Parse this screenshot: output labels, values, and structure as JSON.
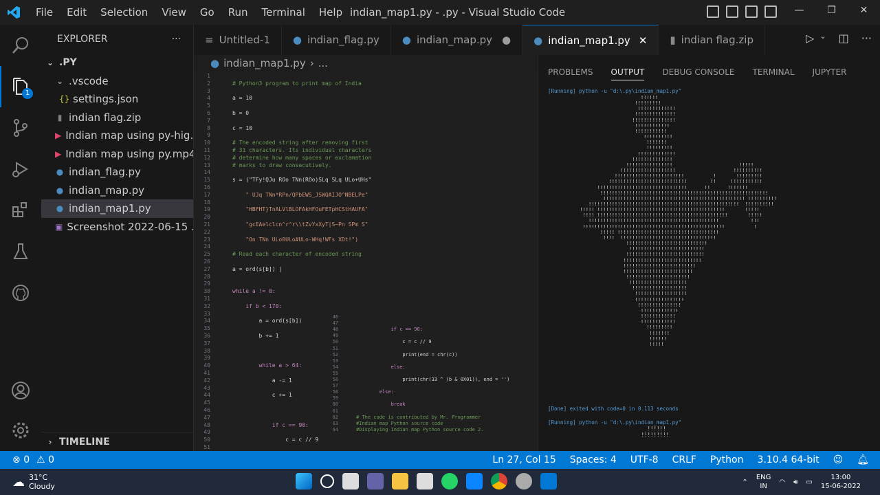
{
  "window_title": "indian_map1.py - .py - Visual Studio Code",
  "menu": [
    "File",
    "Edit",
    "Selection",
    "View",
    "Go",
    "Run",
    "Terminal",
    "Help"
  ],
  "window_controls": [
    "minimize-icon",
    "restore-icon",
    "close-icon"
  ],
  "explorer": {
    "title": "EXPLORER",
    "more": "···",
    "root": ".PY",
    "items": [
      {
        "label": ".vscode",
        "icon": "chevron-down-icon",
        "indent": 1
      },
      {
        "label": "settings.json",
        "icon": "json-icon",
        "indent": 2
      },
      {
        "label": "indian flag.zip",
        "icon": "zip-icon",
        "indent": 1
      },
      {
        "label": "Indian map using py-hig...",
        "icon": "video-icon",
        "indent": 1
      },
      {
        "label": "Indian map using py.mp4",
        "icon": "video-icon",
        "indent": 1
      },
      {
        "label": "indian_flag.py",
        "icon": "python-icon",
        "indent": 1
      },
      {
        "label": "indian_map.py",
        "icon": "python-icon",
        "indent": 1
      },
      {
        "label": "indian_map1.py",
        "icon": "python-icon",
        "indent": 1,
        "selected": true
      },
      {
        "label": "Screenshot 2022-06-15 ...",
        "icon": "image-icon",
        "indent": 1
      }
    ],
    "timeline": "TIMELINE"
  },
  "activity_badge": "1",
  "tabs": [
    {
      "label": "Untitled-1",
      "icon": "file-icon"
    },
    {
      "label": "indian_flag.py",
      "icon": "python-icon"
    },
    {
      "label": "indian_map.py",
      "icon": "python-icon",
      "modified": "●"
    },
    {
      "label": "indian_map1.py",
      "icon": "python-icon",
      "active": true,
      "close": "✕"
    },
    {
      "label": "indian flag.zip",
      "icon": "zip-icon"
    }
  ],
  "breadcrumb": {
    "file": "indian_map1.py",
    "rest": "..."
  },
  "code": [
    {
      "n": "1",
      "t": ""
    },
    {
      "n": "2",
      "t": "# Python3 program to print map of India",
      "c": "cm"
    },
    {
      "n": "3",
      "t": ""
    },
    {
      "n": "4",
      "t": "a = 10"
    },
    {
      "n": "5",
      "t": ""
    },
    {
      "n": "6",
      "t": "b = 0"
    },
    {
      "n": "7",
      "t": ""
    },
    {
      "n": "8",
      "t": "c = 10"
    },
    {
      "n": "9",
      "t": ""
    },
    {
      "n": "10",
      "t": "# The encoded string after removing first",
      "c": "cm"
    },
    {
      "n": "11",
      "t": "# 31 characters. Its individual characters",
      "c": "cm"
    },
    {
      "n": "12",
      "t": "# determine how many spaces or exclamation",
      "c": "cm"
    },
    {
      "n": "13",
      "t": "# marks to draw consecutively.",
      "c": "cm"
    },
    {
      "n": "14",
      "t": ""
    },
    {
      "n": "15",
      "t": "s = (\"TFy!QJu ROo TNn(ROo)SLq SLq ULo+UHs\""
    },
    {
      "n": "16",
      "t": ""
    },
    {
      "n": "17",
      "t": "    \" UJq TNn*RPn/QPbEWS_JSWQAIJO^NBELPe\"",
      "c": "st"
    },
    {
      "n": "18",
      "t": ""
    },
    {
      "n": "19",
      "t": "    \"HBFHT}TnALVlBLOFAkHFOuFETpHCStHAUFA\"",
      "c": "st"
    },
    {
      "n": "20",
      "t": ""
    },
    {
      "n": "21",
      "t": "    \"gcEAelclcn^r^r\\\\tZvYxXyT|S~Pn SPm S\"",
      "c": "st"
    },
    {
      "n": "22",
      "t": ""
    },
    {
      "n": "23",
      "t": "    \"On TNn ULo0ULo#ULo-WHq!WFs XDt!\")",
      "c": "st"
    },
    {
      "n": "24",
      "t": ""
    },
    {
      "n": "25",
      "t": "# Read each character of encoded string",
      "c": "cm"
    },
    {
      "n": "26",
      "t": ""
    },
    {
      "n": "27",
      "t": "a = ord(s[b]) |"
    },
    {
      "n": "28",
      "t": ""
    },
    {
      "n": "29",
      "t": ""
    },
    {
      "n": "30",
      "t": "while a != 0:",
      "c": "kw"
    },
    {
      "n": "31",
      "t": ""
    },
    {
      "n": "32",
      "t": "    if b < 170:",
      "c": "kw"
    },
    {
      "n": "33",
      "t": ""
    },
    {
      "n": "34",
      "t": "        a = ord(s[b])"
    },
    {
      "n": "35",
      "t": ""
    },
    {
      "n": "36",
      "t": "        b += 1"
    },
    {
      "n": "37",
      "t": ""
    },
    {
      "n": "38",
      "t": ""
    },
    {
      "n": "39",
      "t": ""
    },
    {
      "n": "40",
      "t": "        while a > 64:",
      "c": "kw"
    },
    {
      "n": "41",
      "t": ""
    },
    {
      "n": "42",
      "t": "            a -= 1"
    },
    {
      "n": "43",
      "t": ""
    },
    {
      "n": "44",
      "t": "            c += 1"
    },
    {
      "n": "45",
      "t": ""
    },
    {
      "n": "46",
      "t": ""
    },
    {
      "n": "47",
      "t": ""
    },
    {
      "n": "48",
      "t": "            if c == 90:",
      "c": "kw"
    },
    {
      "n": "49",
      "t": ""
    },
    {
      "n": "50",
      "t": "                c = c // 9"
    },
    {
      "n": "51",
      "t": ""
    }
  ],
  "peek": [
    {
      "n": "46",
      "t": ""
    },
    {
      "n": "47",
      "t": ""
    },
    {
      "n": "48",
      "t": "            if c == 90:",
      "c": "kw"
    },
    {
      "n": "49",
      "t": ""
    },
    {
      "n": "50",
      "t": "                c = c // 9"
    },
    {
      "n": "51",
      "t": ""
    },
    {
      "n": "52",
      "t": "                print(end = chr(c))"
    },
    {
      "n": "53",
      "t": ""
    },
    {
      "n": "54",
      "t": "            else:",
      "c": "kw"
    },
    {
      "n": "55",
      "t": ""
    },
    {
      "n": "56",
      "t": "                print(chr(33 ^ (b & 0X01)), end = '')"
    },
    {
      "n": "57",
      "t": ""
    },
    {
      "n": "58",
      "t": "        else:",
      "c": "kw"
    },
    {
      "n": "59",
      "t": ""
    },
    {
      "n": "60",
      "t": "            break",
      "c": "kw"
    },
    {
      "n": "61",
      "t": ""
    },
    {
      "n": "62",
      "t": "# The code is contributed by Mr. Programmer",
      "c": "cm"
    },
    {
      "n": "63",
      "t": "#Indian map Python source code",
      "c": "cm"
    },
    {
      "n": "64",
      "t": "#Displaying Indian map Python source code 2.",
      "c": "cm"
    }
  ],
  "panel": {
    "tabs": [
      "PROBLEMS",
      "OUTPUT",
      "DEBUG CONSOLE",
      "TERMINAL",
      "JUPYTER"
    ],
    "active_tab": "OUTPUT",
    "run_line": "[Running] python -u \"d:\\.py\\indian_map1.py\"",
    "map_lines": [
      "                                !!!!!!",
      "                              !!!!!!!!!",
      "                               !!!!!!!!!!!!!",
      "                              !!!!!!!!!!!!!!",
      "                             !!!!!!!!!!!!!!!",
      "                              !!!!!!!!!!!!",
      "                              !!!!!!!!!!!",
      "                                 !!!!!!!!!!",
      "                                  !!!!!!!",
      "                                  !!!!!!!!!",
      "                               !!!!!!!!!!!!!",
      "                             !!!!!!!!!!!!!!",
      "                           !!!!!!!!!!!!!!!!                       !!!!!",
      "                         !!!!!!!!!!!!!!!!!!!                    !!!!!!!!!!",
      "                       !!!!!!!!!!!!!!!!!!!!!!!!          !       !!!!!!!!!",
      "                     !!!!!!!!!!!!!!!!!!!!!!!!!!!        !!     !!!!!!!!!!!",
      "                 !!!!!!!!!!!!!!!!!!!!!!!!!!!!!!!      !!      !!!!!!!",
      "                  !!!!!!!!!!!!!!!!!!!!!!!!!!!!!!!!!!!!!!!!!!!!!!!!!!!!!!!!!!",
      "                   !!!!!!!!!!!!!!!!!!!!!!!!!!!!!!!!!!!!!!!!!!!!!!!!! !!!!!!!!!!",
      "              !!!!!!!!!!!!!!!!!!!!!!!!!!!!!!!!!!!!!!!!!!!!!!!!!!!!  !!!!!!!!!!",
      "           !!!!! !!!!!!!!!!!!!!!!!!!!!!!!!!!!!!!!!!!!!!!!!!!!       !!!!!",
      "            !!!! !!!!!!!!!!!!!!!!!!!!!!!!!!!!!!!!!!!!!!!!!!!!!       !!!!!",
      "              !!!!!!!!!!!!!!!!!!!!!!!!!!!!!!!!!!!!!!!!!!!!!           !!!",
      "            !!!!!!!!!!!!!!!!!!!!!!!!!!!!!!!!!!!!!!!!!!!!!!!!!          !",
      "                  !!!!! !!!!!!!!!!!!!!!!!!!!!!!!!!!!!!!!!!!",
      "                   !!!!  !!!!!!!!!!!!!!!!!!!!!!!!!!!!!!!!!",
      "                           !!!!!!!!!!!!!!!!!!!!!!!!!!!!",
      "                            !!!!!!!!!!!!!!!!!!!!!!!!!!",
      "                           !!!!!!!!!!!!!!!!!!!!!!!!!!!",
      "                          !!!!!!!!!!!!!!!!!!!!!!!!!!!",
      "                          !!!!!!!!!!!!!!!!!!!!!!!!!",
      "                          !!!!!!!!!!!!!!!!!!!!!!!!",
      "                           !!!!!!!!!!!!!!!!!!!!!!",
      "                            !!!!!!!!!!!!!!!!!!!!",
      "                             !!!!!!!!!!!!!!!!!!!",
      "                              !!!!!!!!!!!!!!!!!!",
      "                              !!!!!!!!!!!!!!!!!",
      "                               !!!!!!!!!!!!!!!",
      "                                !!!!!!!!!!!!!",
      "                                !!!!!!!!!!!!",
      "                                !!!!!!!!!!!!",
      "                                  !!!!!!!!!",
      "                                   !!!!!!!",
      "                                   !!!!!!",
      "                                   !!!!!"
    ],
    "done_line": "[Done] exited with code=0 in 0.113 seconds",
    "run_line2": "[Running] python -u \"d:\\.py\\indian_map1.py\"",
    "tail": [
      "                                !!!!!!",
      "                              !!!!!!!!!"
    ]
  },
  "status": {
    "errors": "0",
    "warnings": "0",
    "position": "Ln 27, Col 15",
    "spaces": "Spaces: 4",
    "encoding": "UTF-8",
    "eol": "CRLF",
    "language": "Python",
    "interpreter": "3.10.4 64-bit"
  },
  "taskbar": {
    "temp": "31°C",
    "condition": "Cloudy",
    "lang": "ENG",
    "region": "IN",
    "time": "13:00",
    "date": "15-06-2022"
  }
}
